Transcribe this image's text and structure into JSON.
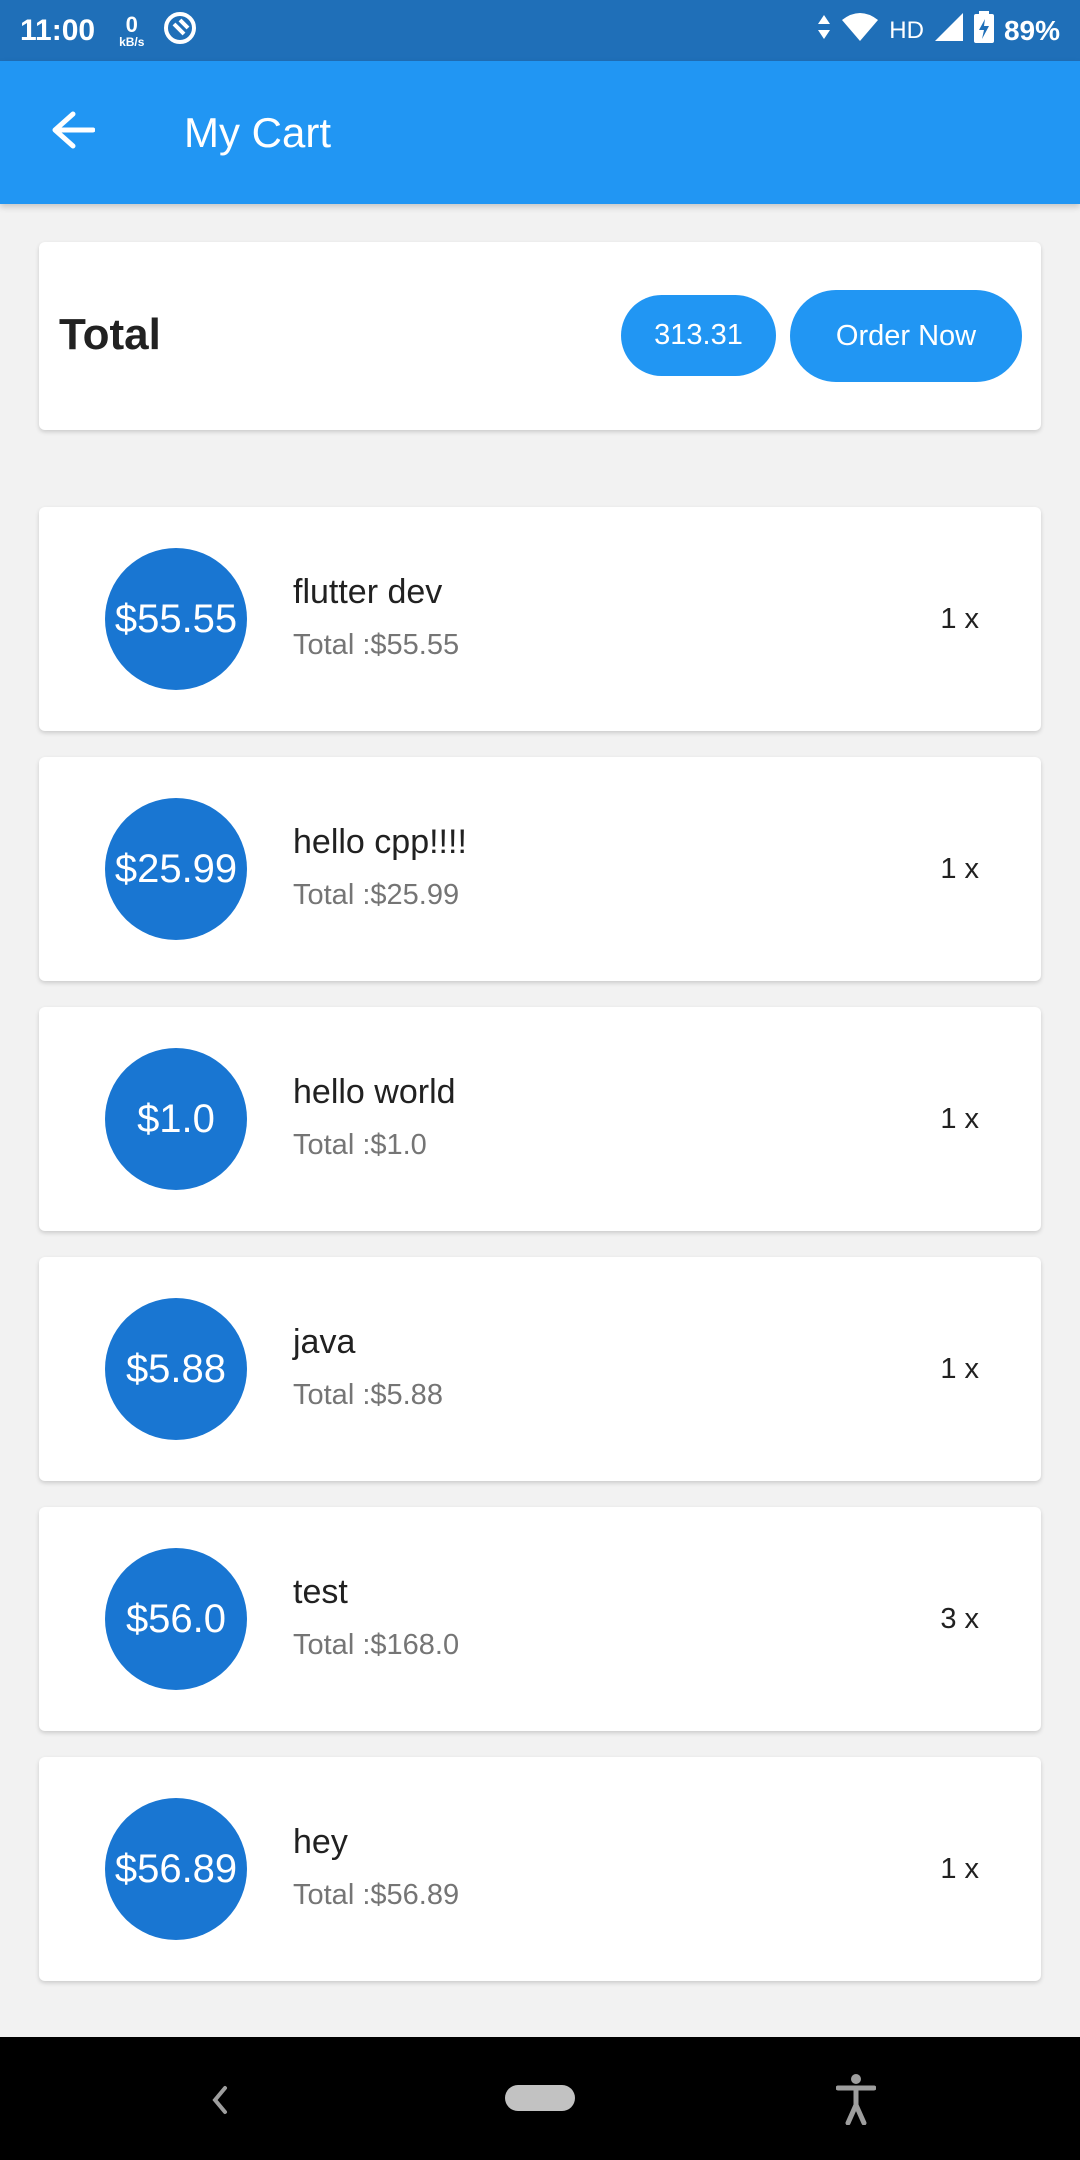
{
  "status_bar": {
    "time": "11:00",
    "data_rate_value": "0",
    "data_rate_unit": "kB/s",
    "network_label": "HD",
    "battery": "89%"
  },
  "app_bar": {
    "title": "My Cart"
  },
  "summary": {
    "label": "Total",
    "amount": "313.31",
    "order_button": "Order Now"
  },
  "items": [
    {
      "price": "$55.55",
      "title": "flutter dev",
      "total": "Total :$55.55",
      "quantity": "1 x"
    },
    {
      "price": "$25.99",
      "title": "hello cpp!!!!",
      "total": "Total :$25.99",
      "quantity": "1 x"
    },
    {
      "price": "$1.0",
      "title": "hello world",
      "total": "Total :$1.0",
      "quantity": "1 x"
    },
    {
      "price": "$5.88",
      "title": "java",
      "total": "Total :$5.88",
      "quantity": "1 x"
    },
    {
      "price": "$56.0",
      "title": "test",
      "total": "Total :$168.0",
      "quantity": "3 x"
    },
    {
      "price": "$56.89",
      "title": "hey",
      "total": "Total :$56.89",
      "quantity": "1 x"
    }
  ],
  "colors": {
    "status_bar": "#1f6fb8",
    "primary": "#2196f3",
    "avatar": "#1976d2",
    "background": "#f2f2f2"
  },
  "icons": {
    "back": "arrow-back-icon",
    "nav_back": "chevron-left-icon",
    "nav_home": "home-pill-icon",
    "accessibility": "accessibility-icon"
  }
}
